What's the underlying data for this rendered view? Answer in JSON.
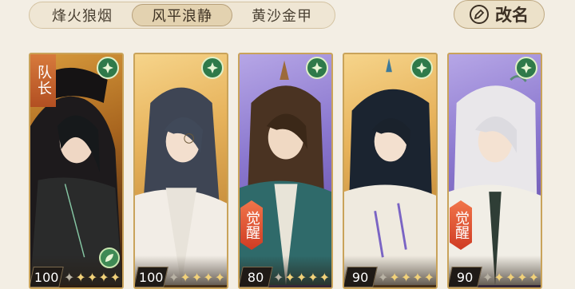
{
  "team_tabs": [
    {
      "label": "烽火狼烟",
      "active": false
    },
    {
      "label": "风平浪静",
      "active": true
    },
    {
      "label": "黄沙金甲",
      "active": false
    }
  ],
  "rename_button": {
    "label": "改名",
    "icon": "pen-icon"
  },
  "cards": [
    {
      "level": "100",
      "stars_total": 5,
      "stars_filled": 4,
      "captain": "队长",
      "awaken": "",
      "bg": "darkgold",
      "extra_badge": "leaf-badge-icon"
    },
    {
      "level": "100",
      "stars_total": 5,
      "stars_filled": 4,
      "captain": "",
      "awaken": "",
      "bg": "gold",
      "extra_badge": ""
    },
    {
      "level": "80",
      "stars_total": 5,
      "stars_filled": 4,
      "captain": "",
      "awaken": "觉醒",
      "bg": "purple",
      "extra_badge": ""
    },
    {
      "level": "90",
      "stars_total": 5,
      "stars_filled": 4,
      "captain": "",
      "awaken": "",
      "bg": "gold",
      "extra_badge": ""
    },
    {
      "level": "90",
      "stars_total": 5,
      "stars_filled": 4,
      "captain": "",
      "awaken": "觉醒",
      "bg": "purple",
      "extra_badge": ""
    }
  ],
  "colors": {
    "accent_green": "#2f7a4a",
    "tab_active": "#e3d2b0",
    "card_border": "#c9a35a"
  }
}
